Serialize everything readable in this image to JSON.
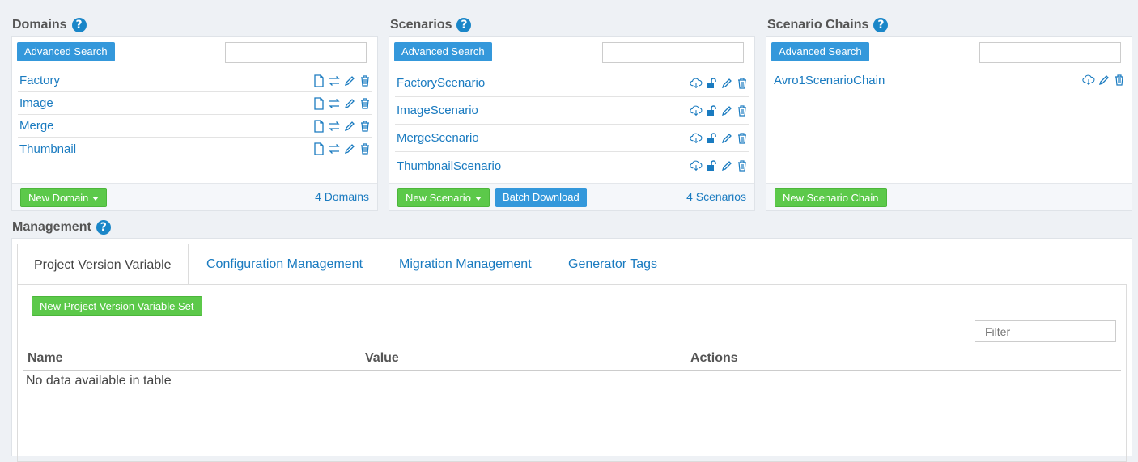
{
  "domains": {
    "title": "Domains",
    "advanced_search": "Advanced Search",
    "search_value": "",
    "items": [
      {
        "label": "Factory"
      },
      {
        "label": "Image"
      },
      {
        "label": "Merge"
      },
      {
        "label": "Thumbnail"
      }
    ],
    "new_button": "New Domain",
    "count": "4 Domains"
  },
  "scenarios": {
    "title": "Scenarios",
    "advanced_search": "Advanced Search",
    "search_value": "",
    "items": [
      {
        "label": "FactoryScenario"
      },
      {
        "label": "ImageScenario"
      },
      {
        "label": "MergeScenario"
      },
      {
        "label": "ThumbnailScenario"
      }
    ],
    "new_button": "New Scenario",
    "batch_download": "Batch Download",
    "count": "4 Scenarios"
  },
  "scenario_chains": {
    "title": "Scenario Chains",
    "advanced_search": "Advanced Search",
    "search_value": "",
    "items": [
      {
        "label": "Avro1ScenarioChain"
      }
    ],
    "new_button": "New Scenario Chain"
  },
  "management": {
    "title": "Management",
    "tabs": [
      {
        "label": "Project Version Variable",
        "active": true
      },
      {
        "label": "Configuration Management",
        "active": false
      },
      {
        "label": "Migration Management",
        "active": false
      },
      {
        "label": "Generator Tags",
        "active": false
      }
    ],
    "new_set_button": "New Project Version Variable Set",
    "filter_placeholder": "Filter",
    "columns": [
      "Name",
      "Value",
      "Actions"
    ],
    "empty_message": "No data available in table"
  },
  "colors": {
    "link": "#1a7bc0",
    "primary_button": "#3498db",
    "success_button": "#5cc94a",
    "help_icon": "#1a86c8"
  },
  "icons": {
    "help": "question-circle-icon",
    "domain_row": [
      "file-icon",
      "exchange-icon",
      "pencil-icon",
      "trash-icon"
    ],
    "scenario_row": [
      "cloud-download-icon",
      "unlock-icon",
      "pencil-icon",
      "trash-icon"
    ],
    "chain_row": [
      "cloud-download-icon",
      "pencil-icon",
      "trash-icon"
    ]
  }
}
